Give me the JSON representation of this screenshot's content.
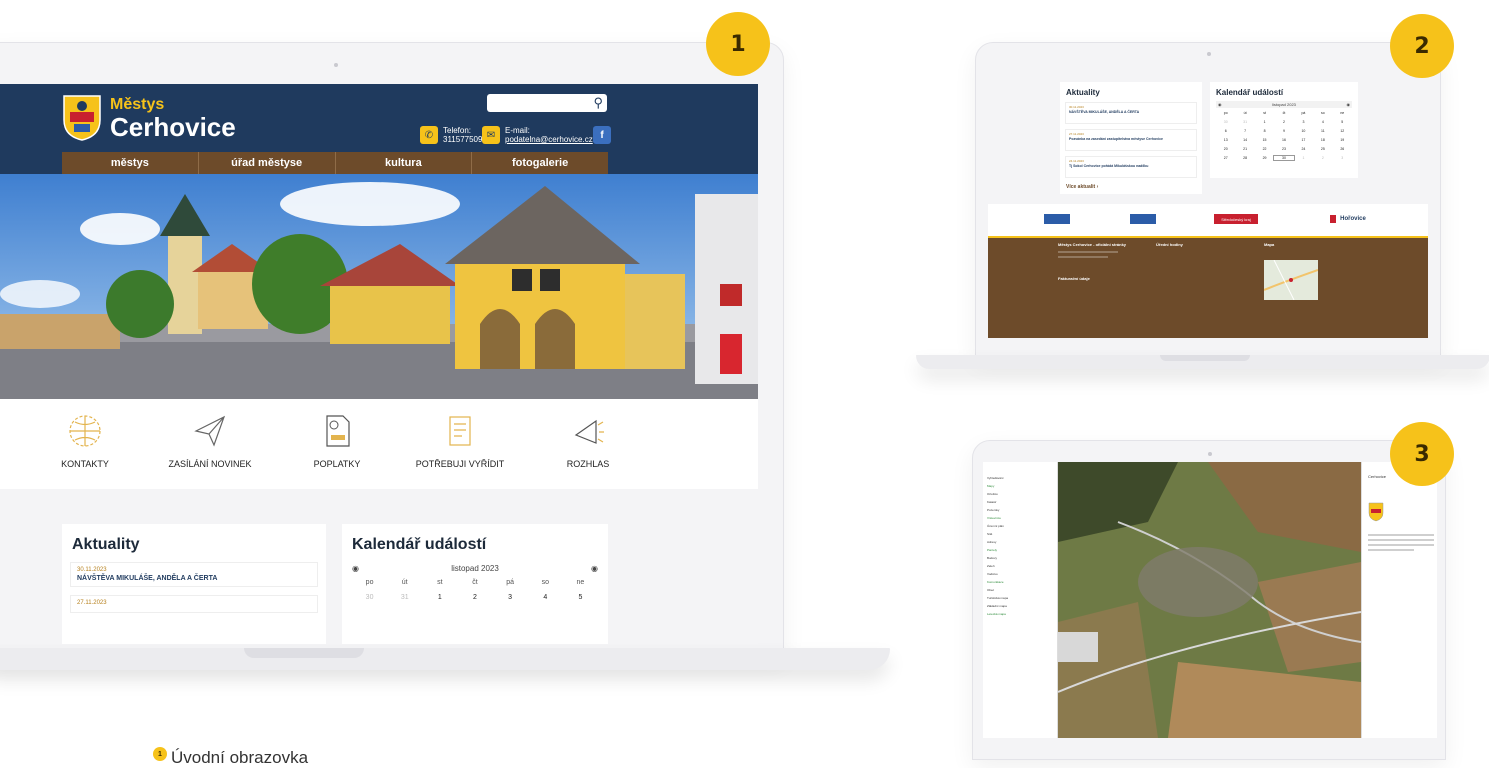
{
  "badges": [
    "1",
    "2",
    "3"
  ],
  "caption": {
    "number": "1",
    "text": "Úvodní obrazovka"
  },
  "screen1": {
    "header": {
      "label_small": "Městys",
      "title": "Cerhovice",
      "phone_label": "Telefon:",
      "phone_value": "311577509",
      "email_label": "E-mail:",
      "email_value": "podatelna@cerhovice.cz",
      "facebook_glyph": "f"
    },
    "nav": [
      "městys",
      "úřad městyse",
      "kultura",
      "fotogalerie"
    ],
    "quick_links": [
      "KONTAKTY",
      "ZASÍLÁNÍ NOVINEK",
      "POPLATKY",
      "POTŘEBUJI VYŘÍDIT",
      "ROZHLAS"
    ],
    "news": {
      "title": "Aktuality",
      "items": [
        {
          "date": "30.11.2023",
          "title": "NÁVŠTĚVA MIKULÁŠE, ANDĚLA A ČERTA"
        },
        {
          "date": "27.11.2023",
          "title": ""
        }
      ]
    },
    "calendar": {
      "title": "Kalendář událostí",
      "month": "listopad 2023",
      "weekdays": [
        "po",
        "út",
        "st",
        "čt",
        "pá",
        "so",
        "ne"
      ],
      "days": [
        "30",
        "31",
        "1",
        "2",
        "3",
        "4",
        "5"
      ],
      "muted_count": 2
    }
  },
  "screen2": {
    "news": {
      "title": "Aktuality",
      "items": [
        {
          "date": "30.11.2023",
          "title": "NÁVŠTĚVA MIKULÁŠE, ANDĚLA A ČERTA"
        },
        {
          "date": "27.11.2023",
          "title": "Pozvánka na zasedání zastupitelstva městyse Cerhovice"
        },
        {
          "date": "24.11.2023",
          "title": "Tj Sokol Cerhovice pořádá Mikulášskou nadílku"
        }
      ],
      "more": "Více aktualit ›"
    },
    "calendar": {
      "title": "Kalendář událostí",
      "month": "listopad 2023",
      "weekdays": [
        "po",
        "út",
        "st",
        "čt",
        "pá",
        "so",
        "ne"
      ],
      "weeks": [
        [
          "30",
          "31",
          "1",
          "2",
          "3",
          "4",
          "5"
        ],
        [
          "6",
          "7",
          "8",
          "9",
          "10",
          "11",
          "12"
        ],
        [
          "13",
          "14",
          "15",
          "16",
          "17",
          "18",
          "19"
        ],
        [
          "20",
          "21",
          "22",
          "23",
          "24",
          "25",
          "26"
        ],
        [
          "27",
          "28",
          "29",
          "30",
          "1",
          "2",
          "3"
        ]
      ]
    },
    "partners": [
      "",
      "",
      "Středočeský kraj",
      "Hořovice"
    ],
    "footer": {
      "title": "Městys Cerhovice - oficiální stránky",
      "hours_title": "Úřední hodiny",
      "map_title": "Mapa",
      "billing_title": "Fakturační údaje"
    }
  },
  "screen3": {
    "panel_title": "Cerhovice",
    "sidebar_rows": [
      "Vyhledávání",
      "Mapy",
      "Ortofoto",
      "Katastr",
      "Pozemky",
      "Vrstevnice",
      "Územní plán",
      "Sítě",
      "Adresy",
      "Parcely",
      "Budovy",
      "Zeleň",
      "Vodstvo",
      "Komunikace",
      "Obec",
      "Turistická mapa",
      "Základní mapa",
      "Letecká mapa"
    ]
  },
  "colors": {
    "navy": "#1f3a5e",
    "brown": "#6d4b2a",
    "yellow": "#f6c21a"
  }
}
